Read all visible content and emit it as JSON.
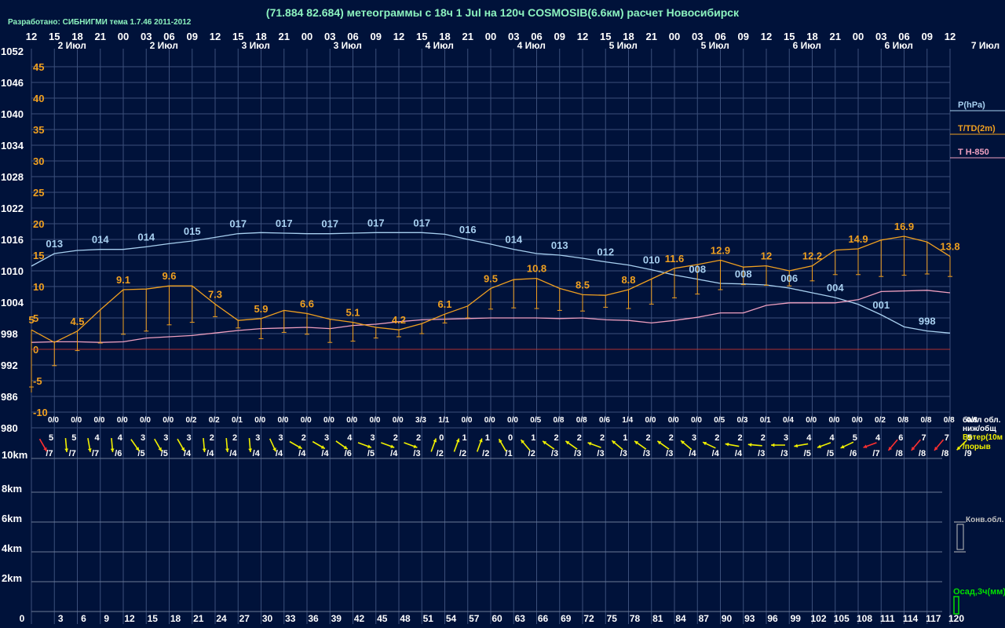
{
  "header": {
    "title": "(71.884 82.684) метеограммы с  18ч 1 Jul на 120ч COSMOSIB(6.6км) расчет Новосибирск",
    "credit": "Разработано: СИБНИГМИ тема 1.7.46 2011-2012"
  },
  "colors": {
    "background": "#00123a",
    "grid": "#3b4f7a",
    "pressure": "#a8d0f0",
    "temperature": "#f0a020",
    "t850": "#f0a0c0",
    "zero_line": "#b03030",
    "wind": "#f0f000",
    "wind_strong": "#ff3030",
    "precip": "#00e000",
    "text": "#ffffff"
  },
  "chart_data": {
    "type": "line",
    "time_axis": {
      "top_hours": [
        "12",
        "15",
        "18",
        "21",
        "00",
        "03",
        "06",
        "09",
        "12",
        "15",
        "18",
        "21",
        "00",
        "03",
        "06",
        "09",
        "12",
        "15",
        "18",
        "21",
        "00",
        "03",
        "06",
        "09",
        "12",
        "15",
        "18",
        "21",
        "00",
        "03",
        "06",
        "09",
        "12",
        "15",
        "18",
        "21",
        "00",
        "03",
        "06",
        "09",
        "12"
      ],
      "forecast_hours": [
        0,
        3,
        6,
        9,
        12,
        15,
        18,
        21,
        24,
        27,
        30,
        33,
        36,
        39,
        42,
        45,
        48,
        51,
        54,
        57,
        60,
        63,
        66,
        69,
        72,
        75,
        78,
        81,
        84,
        87,
        90,
        93,
        96,
        99,
        102,
        105,
        108,
        111,
        114,
        117,
        120
      ],
      "date_labels": [
        {
          "label": "2 Июл",
          "hour": 1
        },
        {
          "label": "2 Июл",
          "hour": 13
        },
        {
          "label": "3 Июл",
          "hour": 25
        },
        {
          "label": "3 Июл",
          "hour": 37
        },
        {
          "label": "4 Июл",
          "hour": 49
        },
        {
          "label": "4 Июл",
          "hour": 61
        },
        {
          "label": "5 Июл",
          "hour": 73
        },
        {
          "label": "5 Июл",
          "hour": 85
        },
        {
          "label": "6 Июл",
          "hour": 97
        },
        {
          "label": "6 Июл",
          "hour": 109
        }
      ],
      "end_date_label": "7 Июл"
    },
    "pressure_axis": {
      "ticks": [
        1052,
        1046,
        1040,
        1034,
        1028,
        1022,
        1016,
        1010,
        1004,
        998,
        992,
        986,
        980
      ],
      "range": [
        980,
        1052
      ]
    },
    "temperature_axis": {
      "ticks": [
        45,
        40,
        35,
        30,
        25,
        20,
        15,
        10,
        5,
        0,
        -5,
        -10
      ],
      "range": [
        -10,
        45
      ]
    },
    "legend": [
      {
        "label": "P(hPa)",
        "color": "#a8d0f0"
      },
      {
        "label": "T/TD(2m)",
        "color": "#f0a020"
      },
      {
        "label": "T H-850",
        "color": "#f0a0c0"
      }
    ],
    "series": [
      {
        "name": "P(hPa)",
        "unit": "hPa",
        "x": [
          0,
          3,
          6,
          9,
          12,
          15,
          18,
          21,
          24,
          27,
          30,
          33,
          36,
          39,
          42,
          45,
          48,
          51,
          54,
          57,
          60,
          63,
          66,
          69,
          72,
          75,
          78,
          81,
          84,
          87,
          90,
          93,
          96,
          99,
          102,
          105,
          108,
          111,
          114,
          117,
          120
        ],
        "values": [
          1010.9,
          1013.3,
          1013.9,
          1014.1,
          1014.1,
          1014.6,
          1015.2,
          1015.7,
          1016.4,
          1017.1,
          1017.3,
          1017.2,
          1017.1,
          1017.1,
          1017.2,
          1017.3,
          1017.3,
          1017.3,
          1017.0,
          1016.0,
          1015.1,
          1014.1,
          1013.3,
          1013.0,
          1012.4,
          1011.7,
          1011.1,
          1010.2,
          1009.2,
          1008.4,
          1007.6,
          1007.5,
          1007.3,
          1006.7,
          1005.8,
          1004.9,
          1003.6,
          1001.6,
          999.3,
          998.5,
          998.1
        ]
      },
      {
        "name": "T/TD(2m)",
        "unit": "°C",
        "x": [
          0,
          3,
          6,
          9,
          12,
          15,
          18,
          21,
          24,
          27,
          30,
          33,
          36,
          39,
          42,
          45,
          48,
          51,
          54,
          57,
          60,
          63,
          66,
          69,
          72,
          75,
          78,
          81,
          84,
          87,
          90,
          93,
          96,
          99,
          102,
          105,
          108,
          111,
          114,
          117,
          120
        ],
        "values": [
          3.1,
          1.1,
          2.9,
          6.3,
          9.5,
          9.6,
          10.1,
          10.1,
          7.2,
          4.6,
          4.9,
          6.2,
          5.7,
          4.8,
          4.3,
          3.5,
          3.1,
          4.1,
          5.6,
          6.9,
          9.7,
          11.1,
          11.3,
          9.7,
          8.7,
          8.6,
          9.5,
          11.2,
          12.9,
          13.5,
          14.2,
          13.1,
          13.3,
          12.5,
          13.3,
          15.8,
          16.0,
          17.4,
          18.0,
          17.1,
          14.8
        ],
        "dewpoint": [
          -6.0,
          -2.6,
          -0.2,
          1.0,
          2.4,
          2.9,
          3.9,
          4.3,
          5.2,
          3.4,
          1.7,
          2.7,
          2.4,
          1.1,
          1.3,
          1.8,
          2.0,
          2.5,
          4.2,
          5.0,
          6.4,
          6.6,
          6.5,
          6.2,
          6.1,
          6.7,
          6.5,
          7.2,
          8.2,
          8.8,
          9.5,
          10.3,
          10.2,
          10.1,
          10.9,
          11.9,
          11.9,
          11.6,
          11.8,
          12.0,
          11.6
        ]
      },
      {
        "name": "T H-850",
        "unit": "°C",
        "x": [
          0,
          3,
          6,
          9,
          12,
          15,
          18,
          21,
          24,
          27,
          30,
          33,
          36,
          39,
          42,
          45,
          48,
          51,
          54,
          57,
          60,
          63,
          66,
          69,
          72,
          75,
          78,
          81,
          84,
          87,
          90,
          93,
          96,
          99,
          102,
          105,
          108,
          111,
          114,
          117,
          120
        ],
        "values": [
          1.1,
          1.2,
          1.2,
          1.1,
          1.2,
          1.8,
          2.0,
          2.2,
          2.6,
          3.0,
          3.3,
          3.4,
          3.5,
          3.3,
          3.8,
          4.0,
          4.4,
          4.7,
          4.8,
          4.9,
          5.0,
          5.0,
          5.0,
          4.9,
          5.0,
          4.7,
          4.6,
          4.2,
          4.6,
          5.1,
          5.8,
          5.8,
          7.0,
          7.4,
          7.4,
          7.4,
          7.9,
          9.2,
          9.3,
          9.4,
          9.0
        ]
      }
    ],
    "data_labels": {
      "pressure": [
        {
          "hour": 3,
          "text": "013"
        },
        {
          "hour": 9,
          "text": "014"
        },
        {
          "hour": 15,
          "text": "014"
        },
        {
          "hour": 21,
          "text": "015"
        },
        {
          "hour": 27,
          "text": "017"
        },
        {
          "hour": 33,
          "text": "017"
        },
        {
          "hour": 39,
          "text": "017"
        },
        {
          "hour": 45,
          "text": "017"
        },
        {
          "hour": 51,
          "text": "017"
        },
        {
          "hour": 57,
          "text": "016"
        },
        {
          "hour": 63,
          "text": "014"
        },
        {
          "hour": 69,
          "text": "013"
        },
        {
          "hour": 75,
          "text": "012"
        },
        {
          "hour": 81,
          "text": "010"
        },
        {
          "hour": 87,
          "text": "008"
        },
        {
          "hour": 93,
          "text": "008"
        },
        {
          "hour": 99,
          "text": "006"
        },
        {
          "hour": 105,
          "text": "004"
        },
        {
          "hour": 111,
          "text": "001"
        },
        {
          "hour": 117,
          "text": "998"
        }
      ],
      "temperature": [
        {
          "hour": 0,
          "text": "5"
        },
        {
          "hour": 6,
          "text": "4.5"
        },
        {
          "hour": 12,
          "text": "9.1"
        },
        {
          "hour": 18,
          "text": "9.6"
        },
        {
          "hour": 24,
          "text": "7.3"
        },
        {
          "hour": 30,
          "text": "5.9"
        },
        {
          "hour": 36,
          "text": "6.6"
        },
        {
          "hour": 42,
          "text": "5.1"
        },
        {
          "hour": 48,
          "text": "4.2"
        },
        {
          "hour": 54,
          "text": "6.1"
        },
        {
          "hour": 60,
          "text": "9.5"
        },
        {
          "hour": 66,
          "text": "10.8"
        },
        {
          "hour": 72,
          "text": "8.5"
        },
        {
          "hour": 78,
          "text": "8.8"
        },
        {
          "hour": 84,
          "text": "11.6"
        },
        {
          "hour": 90,
          "text": "12.9"
        },
        {
          "hour": 96,
          "text": "12"
        },
        {
          "hour": 102,
          "text": "12.2"
        },
        {
          "hour": 108,
          "text": "14.9"
        },
        {
          "hour": 114,
          "text": "16.9"
        },
        {
          "hour": 120,
          "text": "13.8"
        }
      ]
    },
    "cloud_cover": {
      "label_line1": "балл обл.",
      "label_line2": "ниж/общ",
      "values": [
        "0/0",
        "0/0",
        "0/0",
        "0/0",
        "0/0",
        "0/0",
        "0/2",
        "0/2",
        "0/1",
        "0/0",
        "0/0",
        "0/0",
        "0/0",
        "0/0",
        "0/0",
        "0/0",
        "3/3",
        "1/1",
        "0/0",
        "0/0",
        "0/0",
        "0/5",
        "0/8",
        "0/8",
        "0/6",
        "1/4",
        "0/0",
        "0/0",
        "0/0",
        "0/5",
        "0/3",
        "0/1",
        "0/4",
        "0/0",
        "0/0",
        "0/0",
        "0/2",
        "0/8",
        "0/8",
        "0/8",
        "0/8"
      ]
    },
    "wind": {
      "label_line1": "Ветер(10м",
      "label_line2": "/порыв",
      "speed": [
        "5",
        "5",
        "4",
        "4",
        "3",
        "3",
        "3",
        "2",
        "2",
        "3",
        "3",
        "2",
        "3",
        "4",
        "3",
        "2",
        "2",
        "0",
        "1",
        "1",
        "0",
        "1",
        "2",
        "2",
        "2",
        "1",
        "2",
        "2",
        "3",
        "2",
        "2",
        "2",
        "3",
        "4",
        "4",
        "5",
        "4",
        "6",
        "7",
        "7",
        "5"
      ],
      "gust": [
        "/7",
        "/7",
        "/7",
        "/6",
        "/5",
        "/5",
        "/4",
        "/4",
        "/4",
        "/4",
        "/4",
        "/4",
        "/4",
        "/6",
        "/5",
        "/4",
        "/3",
        "/2",
        "/2",
        "/2",
        "/1",
        "/2",
        "/3",
        "/3",
        "/3",
        "/3",
        "/3",
        "/3",
        "/4",
        "/4",
        "/4",
        "/3",
        "/3",
        "/5",
        "/5",
        "/6",
        "/7",
        "/8",
        "/8",
        "/8",
        "/9"
      ],
      "direction_deg": [
        330,
        355,
        350,
        355,
        325,
        330,
        330,
        355,
        355,
        355,
        335,
        300,
        300,
        305,
        290,
        290,
        290,
        200,
        200,
        200,
        150,
        140,
        125,
        125,
        110,
        130,
        125,
        125,
        130,
        115,
        100,
        95,
        90,
        80,
        70,
        65,
        70,
        40,
        40,
        40,
        45
      ],
      "strong": [
        true,
        false,
        false,
        false,
        false,
        false,
        false,
        false,
        false,
        false,
        false,
        false,
        false,
        false,
        false,
        false,
        false,
        false,
        false,
        false,
        false,
        false,
        false,
        false,
        false,
        false,
        false,
        false,
        false,
        false,
        false,
        false,
        false,
        false,
        false,
        false,
        true,
        true,
        true,
        true,
        false
      ]
    },
    "height_axis": {
      "ticks": [
        "10km",
        "8km",
        "6km",
        "4km",
        "2km"
      ]
    },
    "conv_clouds_label": "Конв.обл.",
    "precip_label": "Осад,3ч(мм)"
  }
}
